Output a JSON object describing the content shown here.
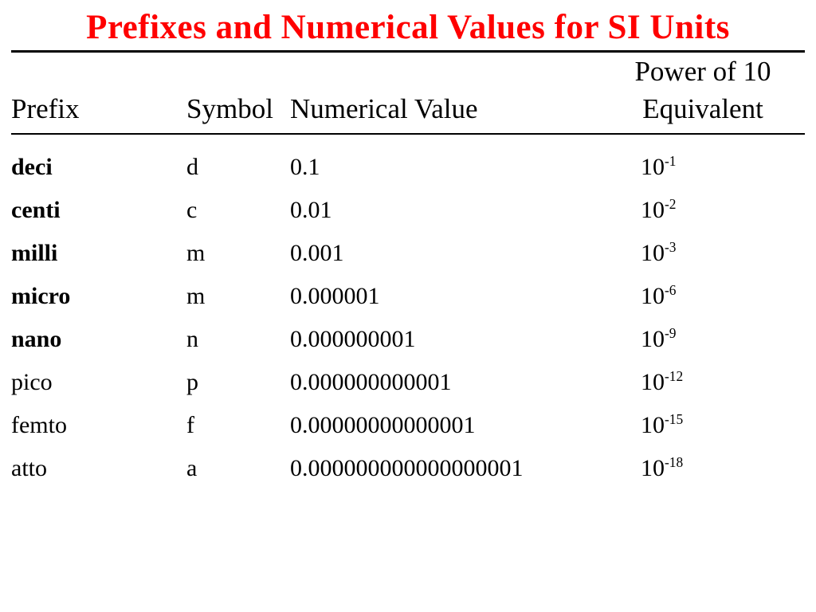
{
  "title": "Prefixes and Numerical Values for SI Units",
  "header": {
    "prefix": "Prefix",
    "symbol": "Symbol",
    "numerical": "Numerical Value",
    "power_line1": "Power of 10",
    "power_line2": "Equivalent"
  },
  "power_base": "10",
  "rows": [
    {
      "prefix": "deci",
      "bold": true,
      "symbol": "d",
      "numerical": "0.1",
      "exp": "-1"
    },
    {
      "prefix": "centi",
      "bold": true,
      "symbol": "c",
      "numerical": "0.01",
      "exp": "-2"
    },
    {
      "prefix": "milli",
      "bold": true,
      "symbol": "m",
      "numerical": "0.001",
      "exp": "-3"
    },
    {
      "prefix": "micro",
      "bold": true,
      "symbol": "m",
      "numerical": "0.000001",
      "exp": "-6"
    },
    {
      "prefix": "nano",
      "bold": true,
      "symbol": "n",
      "numerical": "0.000000001",
      "exp": "-9"
    },
    {
      "prefix": "pico",
      "bold": false,
      "symbol": "p",
      "numerical": "0.000000000001",
      "exp": "-12"
    },
    {
      "prefix": "femto",
      "bold": false,
      "symbol": "f",
      "numerical": "0.00000000000001",
      "exp": "-15"
    },
    {
      "prefix": "atto",
      "bold": false,
      "symbol": "a",
      "numerical": "0.000000000000000001",
      "exp": "-18"
    }
  ],
  "chart_data": {
    "type": "table",
    "title": "Prefixes and Numerical Values for SI Units",
    "columns": [
      "Prefix",
      "Symbol",
      "Numerical Value",
      "Power of 10 Equivalent"
    ],
    "rows": [
      [
        "deci",
        "d",
        0.1,
        "10^-1"
      ],
      [
        "centi",
        "c",
        0.01,
        "10^-2"
      ],
      [
        "milli",
        "m",
        0.001,
        "10^-3"
      ],
      [
        "micro",
        "m",
        1e-06,
        "10^-6"
      ],
      [
        "nano",
        "n",
        1e-09,
        "10^-9"
      ],
      [
        "pico",
        "p",
        1e-12,
        "10^-12"
      ],
      [
        "femto",
        "f",
        1e-14,
        "10^-15"
      ],
      [
        "atto",
        "a",
        1e-18,
        "10^-18"
      ]
    ]
  }
}
